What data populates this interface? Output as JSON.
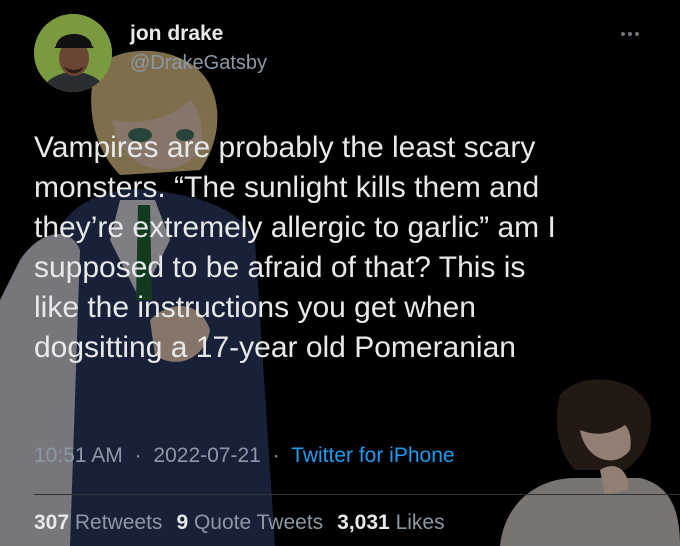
{
  "author": {
    "name": "jon drake",
    "handle": "@DrakeGatsby"
  },
  "tweet": {
    "lines": [
      "Vampires are probably the least scary",
      "monsters. “The sunlight kills them and",
      "they’re extremely allergic to garlic” am I",
      "supposed to be afraid of that? This is",
      "like the instructions you get when",
      "dogsitting a 17-year old Pomeranian"
    ]
  },
  "meta": {
    "time": "10:51 AM",
    "date": "2022-07-21",
    "separator": "·",
    "source": "Twitter for iPhone"
  },
  "stats": {
    "retweets_count": "307",
    "retweets_label": "Retweets",
    "quotes_count": "9",
    "quotes_label": "Quote Tweets",
    "likes_count": "3,031",
    "likes_label": "Likes"
  },
  "colors": {
    "background": "#000000",
    "text": "#e7e9ea",
    "secondary": "#8b98a5",
    "link": "#1d9bf0"
  },
  "icons": {
    "more": "more-horizontal-icon"
  }
}
